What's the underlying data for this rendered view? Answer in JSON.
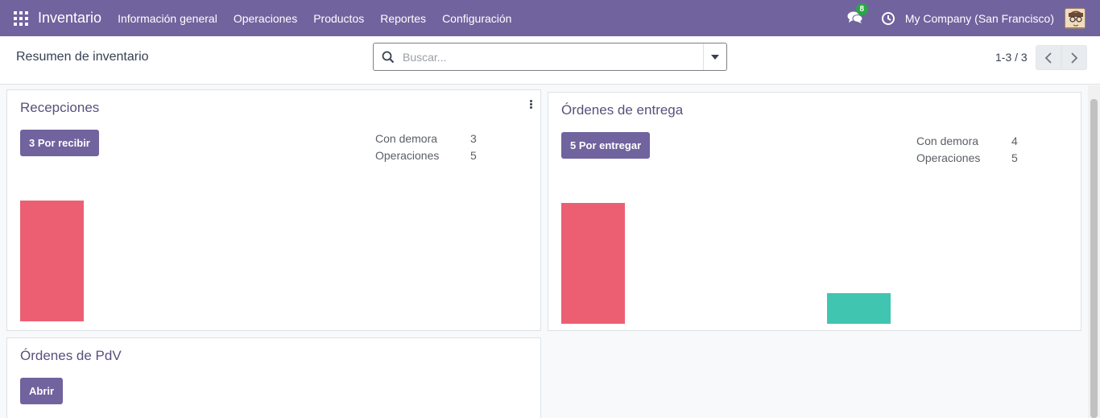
{
  "navbar": {
    "app_name": "Inventario",
    "menu": [
      "Información general",
      "Operaciones",
      "Productos",
      "Reportes",
      "Configuración"
    ],
    "messages_count": "8",
    "company": "My Company (San Francisco)",
    "color": "#71639e"
  },
  "control_panel": {
    "title": "Resumen de inventario",
    "search_placeholder": "Buscar...",
    "pager": "1-3 / 3"
  },
  "cards": [
    {
      "title": "Recepciones",
      "button": "3 Por recibir",
      "stats": [
        {
          "label": "Con demora",
          "value": "3"
        },
        {
          "label": "Operaciones",
          "value": "5"
        }
      ],
      "bars": [
        {
          "value": 1.0,
          "color": "#ec5f73"
        }
      ]
    },
    {
      "title": "Órdenes de entrega",
      "button": "5 Por entregar",
      "stats": [
        {
          "label": "Con demora",
          "value": "4"
        },
        {
          "label": "Operaciones",
          "value": "5"
        }
      ],
      "bars": [
        {
          "value": 1.0,
          "color": "#ec5f73"
        },
        {
          "value": 0.25,
          "color": "#40c5b1"
        }
      ]
    },
    {
      "title": "Órdenes de PdV",
      "button": "Abrir"
    }
  ]
}
